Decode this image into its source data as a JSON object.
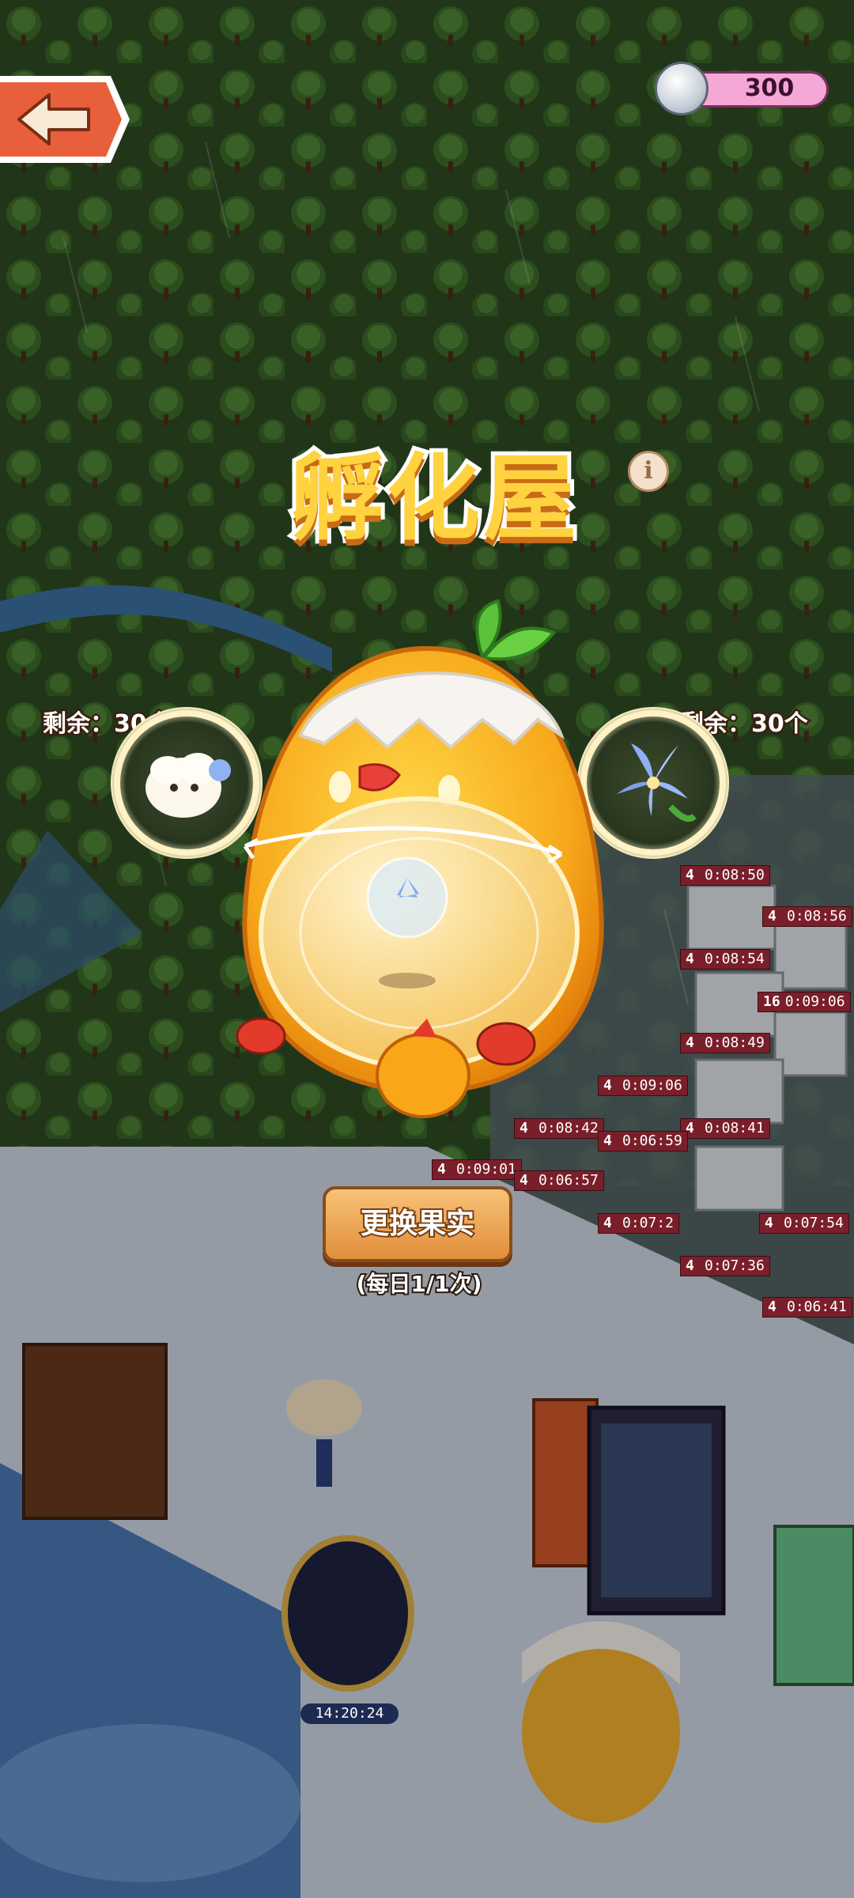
{
  "header": {
    "back_label": "back",
    "coin_icon": "coin-icon",
    "coin_value": "300"
  },
  "incubator": {
    "title": "孵化屋",
    "info_icon": "info-icon",
    "left_remaining": "剩余：30个",
    "right_remaining": "剩余：30个",
    "swap_button": "更换果实",
    "daily_limit": "(每日1/1次)"
  },
  "timers": [
    {
      "count": "4",
      "time": "0:08:50"
    },
    {
      "count": "4",
      "time": "0:08:56"
    },
    {
      "count": "4",
      "time": "0:08:54"
    },
    {
      "count": "16",
      "time": "0:09:06"
    },
    {
      "count": "4",
      "time": "0:08:49"
    },
    {
      "count": "4",
      "time": "0:09:06"
    },
    {
      "count": "4",
      "time": "0:08:42"
    },
    {
      "count": "4",
      "time": "0:08:41"
    },
    {
      "count": "4",
      "time": "0:06:59"
    },
    {
      "count": "4",
      "time": "0:09:01"
    },
    {
      "count": "4",
      "time": "0:06:57"
    },
    {
      "count": "4",
      "time": "0:07:2"
    },
    {
      "count": "4",
      "time": "0:07:54"
    },
    {
      "count": "4",
      "time": "0:07:36"
    },
    {
      "count": "4",
      "time": "0:06:41"
    }
  ],
  "bottom_timer": "14:20:24",
  "colors": {
    "accent_orange": "#e08e3a",
    "coin_pill": "#f5a7d6",
    "title_yellow": "#ffd23f"
  }
}
